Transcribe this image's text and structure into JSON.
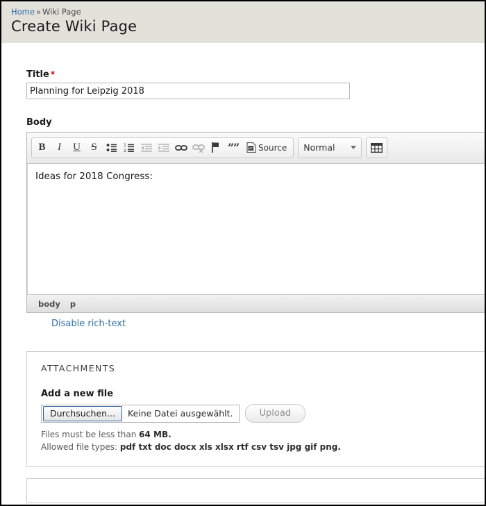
{
  "header": {
    "breadcrumb": {
      "home": "Home",
      "separator": "»",
      "current": "Wiki Page"
    },
    "title": "Create Wiki Page"
  },
  "form": {
    "title_field": {
      "label": "Title",
      "required_marker": "*",
      "value": "Planning for Leipzig 2018"
    },
    "body_field": {
      "label": "Body",
      "content": "Ideas for 2018 Congress:",
      "disable_rich_text_link": "Disable rich-text"
    }
  },
  "editor": {
    "toolbar": {
      "bold": "B",
      "italic": "I",
      "underline": "U",
      "strikethrough": "S",
      "bulleted_list": "bulleted-list-icon",
      "numbered_list": "numbered-list-icon",
      "outdent": "outdent-icon",
      "indent": "indent-icon",
      "link": "link-icon",
      "unlink": "unlink-icon",
      "anchor": "flag-icon",
      "blockquote": "quote-icon",
      "source_label": "Source",
      "format_select": "Normal",
      "table": "table-icon"
    },
    "status_path": [
      "body",
      "p"
    ]
  },
  "attachments": {
    "legend": "ATTACHMENTS",
    "add_file_label": "Add a new file",
    "browse_button": "Durchsuchen...",
    "file_name": "Keine Datei ausgewählt.",
    "upload_button": "Upload",
    "size_help_prefix": "Files must be less than ",
    "size_help_value": "64 MB.",
    "types_help_prefix": "Allowed file types: ",
    "types_help_value": "pdf txt doc docx xls xlsx rtf csv tsv jpg gif png."
  },
  "colors": {
    "header_band": "#e2e1da",
    "link": "#2f6fa8",
    "required": "#e3000f",
    "browse_border": "#2b5f9e"
  }
}
